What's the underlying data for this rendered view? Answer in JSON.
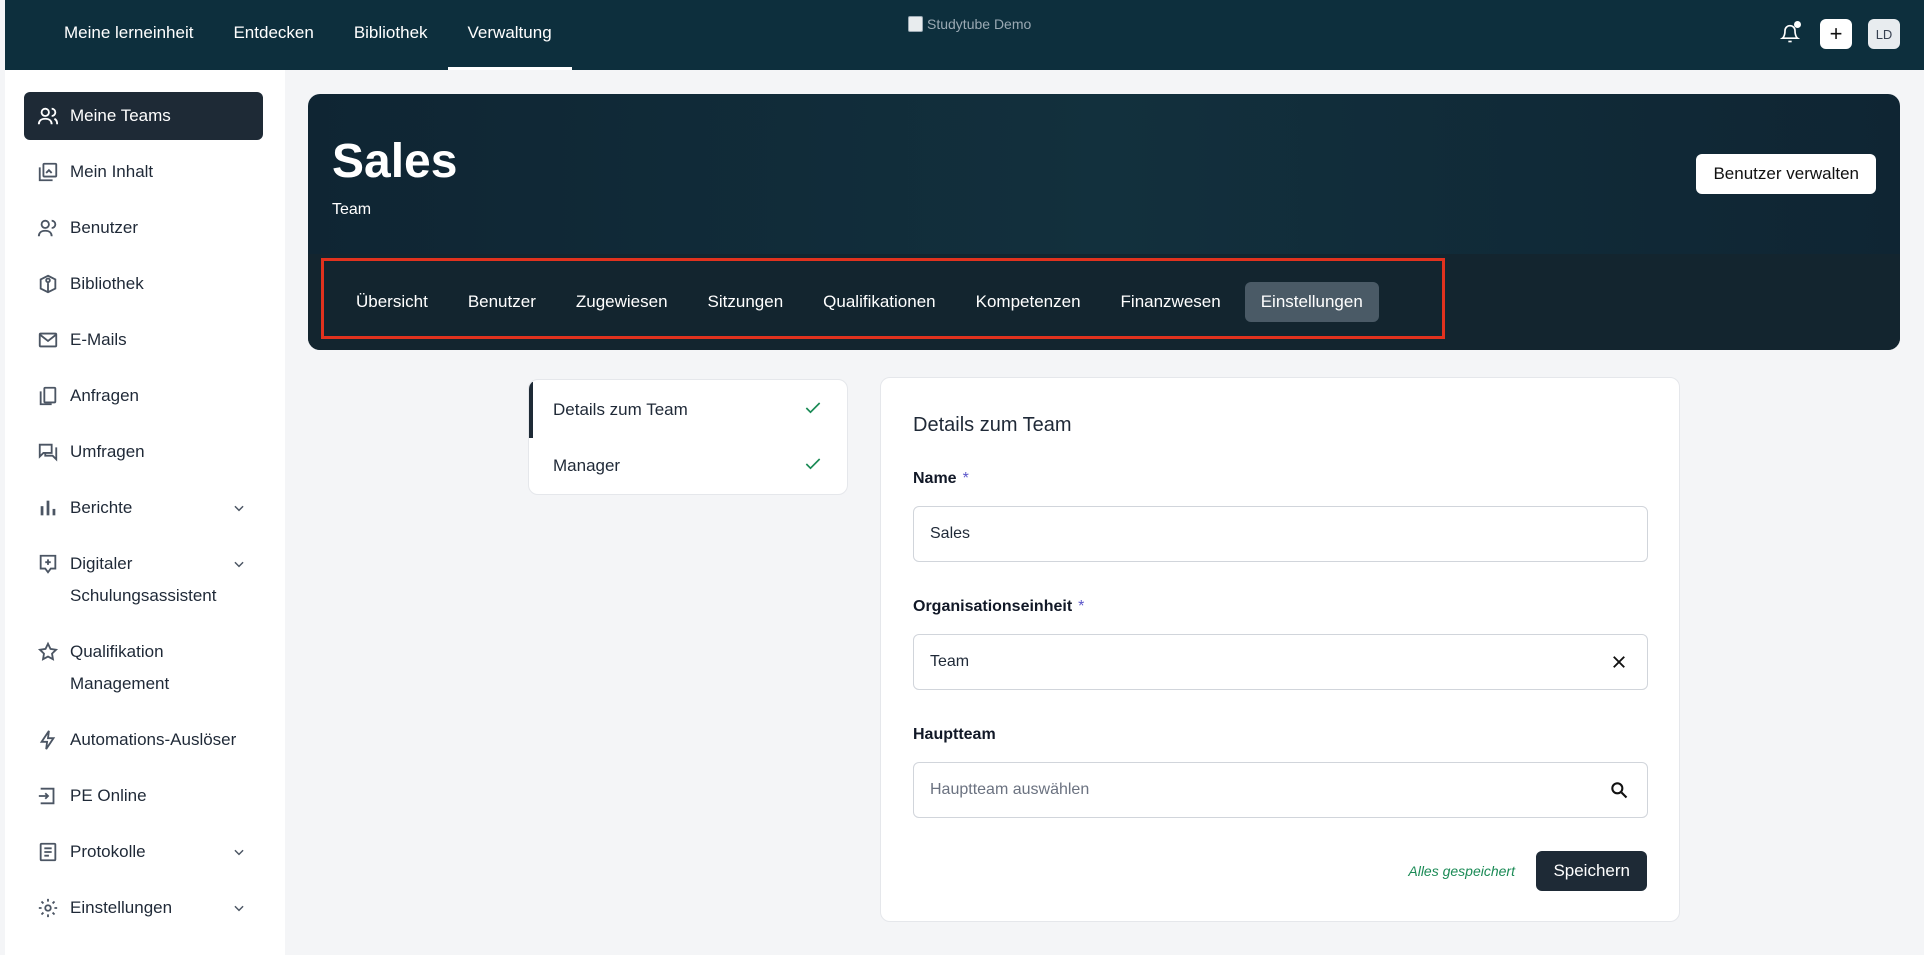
{
  "topnav": {
    "items": [
      {
        "label": "Meine lerneinheit"
      },
      {
        "label": "Entdecken"
      },
      {
        "label": "Bibliothek"
      },
      {
        "label": "Verwaltung"
      }
    ],
    "logo_alt": "Studytube Demo",
    "avatar_initials": "LD",
    "plus_symbol": "+"
  },
  "sidebar": {
    "items": [
      {
        "label": "Meine Teams",
        "icon": "users-icon"
      },
      {
        "label": "Mein Inhalt",
        "icon": "content-icon"
      },
      {
        "label": "Benutzer",
        "icon": "user-icon"
      },
      {
        "label": "Bibliothek",
        "icon": "library-icon"
      },
      {
        "label": "E-Mails",
        "icon": "mail-icon"
      },
      {
        "label": "Anfragen",
        "icon": "copy-icon"
      },
      {
        "label": "Umfragen",
        "icon": "survey-icon"
      },
      {
        "label": "Berichte",
        "icon": "chart-icon"
      },
      {
        "label": "Digitaler",
        "label2": "Schulungsassistent",
        "icon": "assistant-icon"
      },
      {
        "label": "Qualifikation",
        "label2": "Management",
        "icon": "star-icon"
      },
      {
        "label": "Automations-Auslöser",
        "icon": "bolt-icon"
      },
      {
        "label": "PE Online",
        "icon": "login-icon"
      },
      {
        "label": "Protokolle",
        "icon": "log-icon"
      },
      {
        "label": "Einstellungen",
        "icon": "gear-icon"
      }
    ]
  },
  "hero": {
    "title": "Sales",
    "subtitle": "Team",
    "manage_button": "Benutzer verwalten",
    "tabs": [
      {
        "label": "Übersicht"
      },
      {
        "label": "Benutzer"
      },
      {
        "label": "Zugewiesen"
      },
      {
        "label": "Sitzungen"
      },
      {
        "label": "Qualifikationen"
      },
      {
        "label": "Kompetenzen"
      },
      {
        "label": "Finanzwesen"
      },
      {
        "label": "Einstellungen"
      }
    ]
  },
  "steps": [
    {
      "label": "Details zum Team"
    },
    {
      "label": "Manager"
    }
  ],
  "form": {
    "title": "Details zum Team",
    "name_label": "Name",
    "name_value": "Sales",
    "org_label": "Organisationseinheit",
    "org_value": "Team",
    "parent_label": "Hauptteam",
    "parent_placeholder": "Hauptteam auswählen",
    "required_mark": "*",
    "saved_status": "Alles gespeichert",
    "save_button": "Speichern"
  },
  "colors": {
    "topbar": "#0d2f3d",
    "accent_dark": "#1e2a36",
    "success": "#1a8a55",
    "highlight": "#e1321e"
  }
}
